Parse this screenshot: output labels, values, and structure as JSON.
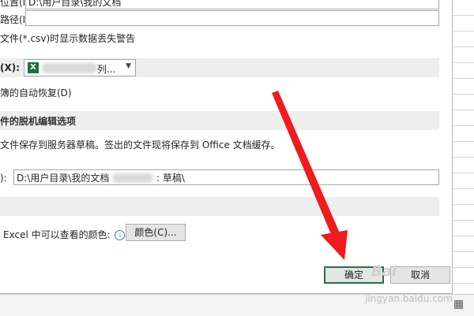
{
  "dialog": {
    "row1_label": "位置(I):",
    "row1_value": "D:\\用户目录\\我的文档",
    "row2_label": "路径(I):",
    "csv_warning": "文件(*.csv)时显示数据丢失警告",
    "exceptions_label": "(X):",
    "exceptions_value": "列...",
    "disable_autorecover": "簿的自动恢复(D)",
    "offline_section": "件的脱机编辑选项",
    "offline_desc": "文件保存到服务器草稿。签出的文件现将保存到 Office 文档缓存。",
    "drafts_label": "):",
    "drafts_value_prefix": "D:\\用户目录\\我的文档",
    "drafts_value_suffix": ": 草稿\\",
    "colors_text": "Excel 中可以查看的颜色:",
    "colors_button": "颜色(C)...",
    "ok_button": "确定",
    "cancel_button": "取消"
  },
  "watermark": {
    "logo": "Bai",
    "url": "jingyan.baidu.com"
  },
  "colors": {
    "section_bg": "#eeeeee",
    "excel_green": "#1d6f42",
    "ok_border": "#217346",
    "arrow_red": "#ee1c1c"
  }
}
